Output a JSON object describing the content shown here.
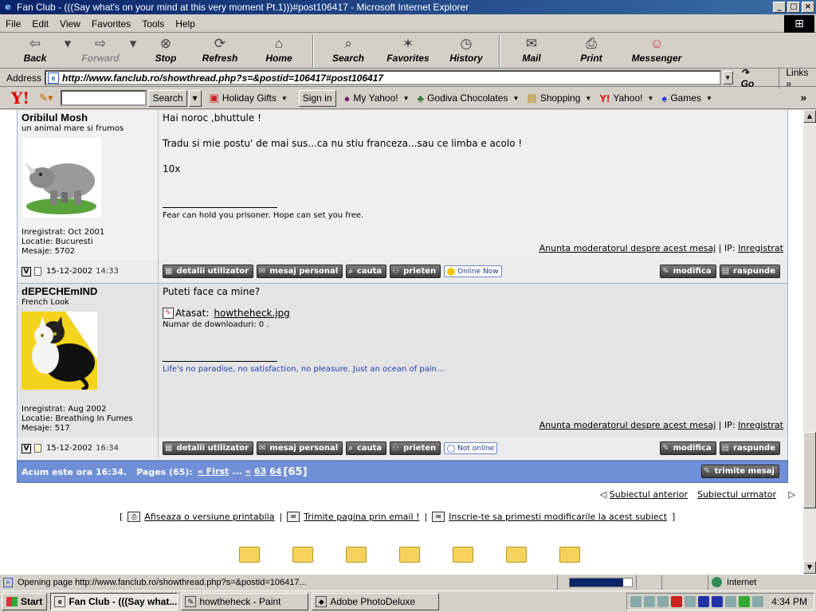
{
  "window": {
    "title": "Fan Club - (((Say what's on your mind at this very moment Pt.1)))#post106417 - Microsoft Internet Explorer",
    "controls": {
      "minimize": "_",
      "maximize": "□",
      "close": "×"
    }
  },
  "menu": [
    "File",
    "Edit",
    "View",
    "Favorites",
    "Tools",
    "Help"
  ],
  "toolbar": {
    "back": "Back",
    "forward": "Forward",
    "stop": "Stop",
    "refresh": "Refresh",
    "home": "Home",
    "search": "Search",
    "favorites": "Favorites",
    "history": "History",
    "mail": "Mail",
    "print": "Print",
    "messenger": "Messenger"
  },
  "address": {
    "label": "Address",
    "url": "http://www.fanclub.ro/showthread.php?s=&postid=106417#post106417",
    "go": "Go",
    "links": "Links"
  },
  "yahoo": {
    "logo": "Y!",
    "search_button": "Search",
    "search_value": "",
    "items": [
      "Holiday Gifts",
      "Sign in",
      "My Yahoo!",
      "Godiva Chocolates",
      "Shopping",
      "Yahoo!",
      "Games"
    ]
  },
  "posts": [
    {
      "username": "Oribilul Mosh",
      "usertitle": "un animal mare si frumos",
      "avatar": "rhino-avatar",
      "registered": "Inregistrat: Oct 2001",
      "location": "Locatie: Bucuresti",
      "messages": "Mesaje: 5702",
      "lines": [
        "Hai noroc ,bhuttule !",
        "Tradu si mie postu' de mai sus...ca nu stiu franceza...sau ce limba e acolo !",
        "10x"
      ],
      "signature": "Fear can hold you prisoner. Hope can set you free.",
      "report": "Anunta moderatorul despre acest mesaj",
      "ip_label": "| IP:",
      "ip_value": "Inregistrat",
      "date": "15-12-2002",
      "time": "14:33",
      "status": "Online Now"
    },
    {
      "username": "dEPECHEmIND",
      "usertitle": "French Look",
      "avatar": "cat-avatar",
      "registered": "Inregistrat: Aug 2002",
      "location": "Locatie: Breathing In Fumes",
      "messages": "Mesaje: 517",
      "lines": [
        "Puteti face ca mine?"
      ],
      "attachment_label": "Atasat:",
      "attachment_file": "howtheheck.jpg",
      "downloads": "Numar de downloaduri: 0 .",
      "signature": "Life's no paradise, no satisfaction, no pleasure. Just an ocean of pain...",
      "report": "Anunta moderatorul despre acest mesaj",
      "ip_label": "| IP:",
      "ip_value": "Inregistrat",
      "date": "15-12-2002",
      "time": "16:34",
      "status": "Not online"
    }
  ],
  "post_buttons": {
    "details": "detalii utilizator",
    "pm": "mesaj personal",
    "search": "cauta",
    "friend": "prieten",
    "edit": "modifica",
    "reply": "raspunde"
  },
  "footer": {
    "time_text": "Acum este ora 16:34.",
    "pages_label": "Pages (65):",
    "first": "« First",
    "ellipsis": "...",
    "prev": "«",
    "page_a": "63",
    "page_b": "64",
    "current": "[65]",
    "send": "trimite mesaj"
  },
  "thread_nav": {
    "prev": "Subiectul anterior",
    "next": "Subiectul urmator"
  },
  "tools": {
    "open_bracket": "[",
    "printable": "Afiseaza o versiune printabila",
    "email": "Trimite pagina prin email !",
    "subscribe": "Inscrie-te sa primesti modificarile la acest subiect",
    "sep": "|",
    "close_bracket": "]"
  },
  "statusbar": {
    "text": "Opening page http://www.fanclub.ro/showthread.php?s=&postid=106417...",
    "progress": 0.86,
    "zone": "Internet"
  },
  "taskbar": {
    "start": "Start",
    "tasks": [
      "Fan Club - (((Say what...",
      "howtheheck - Paint",
      "Adobe PhotoDeluxe"
    ],
    "clock": "4:34 PM"
  }
}
